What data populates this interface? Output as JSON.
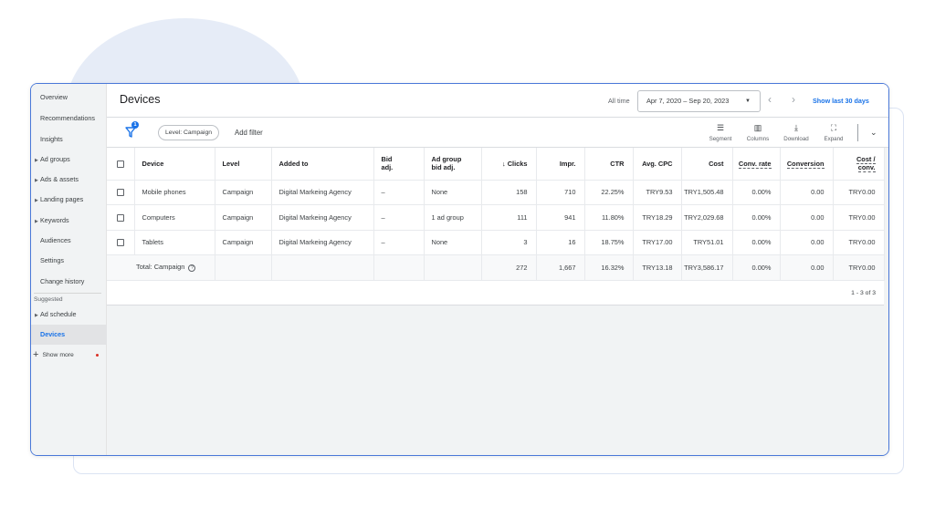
{
  "sidebar": {
    "items": [
      {
        "label": "Overview"
      },
      {
        "label": "Recommendations"
      },
      {
        "label": "Insights"
      },
      {
        "label": "Ad groups"
      },
      {
        "label": "Ads & assets"
      },
      {
        "label": "Landing pages"
      },
      {
        "label": "Keywords"
      },
      {
        "label": "Audiences"
      },
      {
        "label": "Settings"
      },
      {
        "label": "Change history"
      }
    ],
    "suggested_label": "Suggested",
    "suggested_items": [
      {
        "label": "Ad schedule"
      },
      {
        "label": "Devices"
      }
    ],
    "show_more": "Show more"
  },
  "header": {
    "title": "Devices",
    "all_time": "All time",
    "date_range": "Apr 7, 2020 – Sep 20, 2023",
    "show_last": "Show last 30 days"
  },
  "toolbar": {
    "filter_count": "1",
    "level_chip": "Level: Campaign",
    "add_filter": "Add filter",
    "segment": "Segment",
    "columns": "Columns",
    "download": "Download",
    "expand": "Expand"
  },
  "table": {
    "headers": {
      "device": "Device",
      "level": "Level",
      "added_to": "Added to",
      "bid_adj_1": "Bid",
      "bid_adj_2": "adj.",
      "ag_bid_1": "Ad group",
      "ag_bid_2": "bid adj.",
      "clicks": "Clicks",
      "impr": "Impr.",
      "ctr": "CTR",
      "avg_cpc": "Avg. CPC",
      "cost": "Cost",
      "conv_rate": "Conv. rate",
      "conversion": "Conversion",
      "cost_conv_1": "Cost /",
      "cost_conv_2": "conv."
    },
    "rows": [
      {
        "device": "Mobile phones",
        "level": "Campaign",
        "added_to": "Digital Markeing Agency",
        "bid_adj": "–",
        "ag_bid_adj": "None",
        "clicks": "158",
        "impr": "710",
        "ctr": "22.25%",
        "avg_cpc": "TRY9.53",
        "cost": "TRY1,505.48",
        "conv_rate": "0.00%",
        "conversion": "0.00",
        "cost_conv": "TRY0.00"
      },
      {
        "device": "Computers",
        "level": "Campaign",
        "added_to": "Digital Markeing Agency",
        "bid_adj": "–",
        "ag_bid_adj": "1 ad group",
        "clicks": "111",
        "impr": "941",
        "ctr": "11.80%",
        "avg_cpc": "TRY18.29",
        "cost": "TRY2,029.68",
        "conv_rate": "0.00%",
        "conversion": "0.00",
        "cost_conv": "TRY0.00"
      },
      {
        "device": "Tablets",
        "level": "Campaign",
        "added_to": "Digital Markeing Agency",
        "bid_adj": "–",
        "ag_bid_adj": "None",
        "clicks": "3",
        "impr": "16",
        "ctr": "18.75%",
        "avg_cpc": "TRY17.00",
        "cost": "TRY51.01",
        "conv_rate": "0.00%",
        "conversion": "0.00",
        "cost_conv": "TRY0.00"
      }
    ],
    "total": {
      "label": "Total: Campaign",
      "clicks": "272",
      "impr": "1,667",
      "ctr": "16.32%",
      "avg_cpc": "TRY13.18",
      "cost": "TRY3,586.17",
      "conv_rate": "0.00%",
      "conversion": "0.00",
      "cost_conv": "TRY0.00"
    },
    "pager": "1 - 3 of 3"
  },
  "colors": {
    "accent": "#1a73e8",
    "frame": "#4a78d8",
    "badge": "#1a73e8",
    "notification_dot": "#d93025"
  }
}
